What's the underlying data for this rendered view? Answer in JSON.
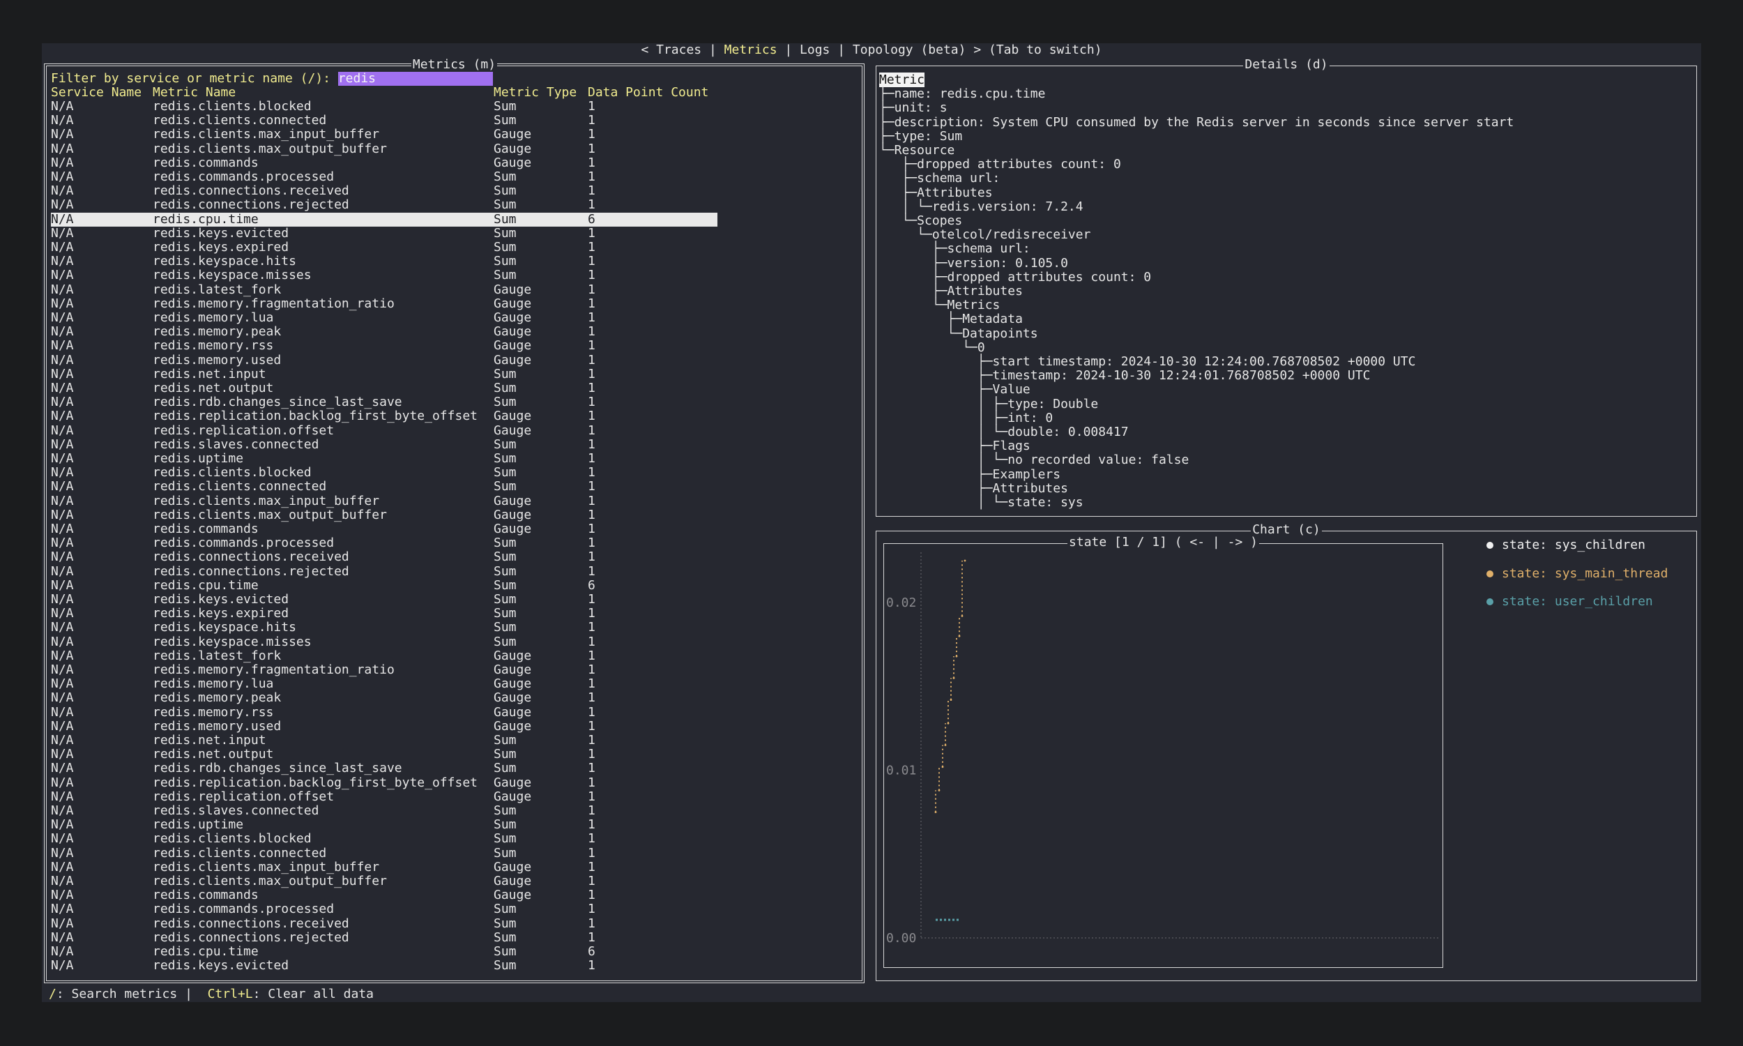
{
  "nav": {
    "prefix": "< ",
    "tabs": [
      "Traces",
      "Metrics",
      "Logs",
      "Topology (beta)"
    ],
    "active": "Metrics",
    "suffix": " > (Tab to switch)"
  },
  "metrics_panel": {
    "title": "Metrics (m)",
    "filter_label": "Filter by service or metric name (/): ",
    "filter_value": "redis",
    "columns": [
      "Service Name",
      "Metric Name",
      "Metric Type",
      "Data Point Count"
    ],
    "selected_index": 8,
    "rows": [
      [
        "N/A",
        "redis.clients.blocked",
        "Sum",
        "1"
      ],
      [
        "N/A",
        "redis.clients.connected",
        "Sum",
        "1"
      ],
      [
        "N/A",
        "redis.clients.max_input_buffer",
        "Gauge",
        "1"
      ],
      [
        "N/A",
        "redis.clients.max_output_buffer",
        "Gauge",
        "1"
      ],
      [
        "N/A",
        "redis.commands",
        "Gauge",
        "1"
      ],
      [
        "N/A",
        "redis.commands.processed",
        "Sum",
        "1"
      ],
      [
        "N/A",
        "redis.connections.received",
        "Sum",
        "1"
      ],
      [
        "N/A",
        "redis.connections.rejected",
        "Sum",
        "1"
      ],
      [
        "N/A",
        "redis.cpu.time",
        "Sum",
        "6"
      ],
      [
        "N/A",
        "redis.keys.evicted",
        "Sum",
        "1"
      ],
      [
        "N/A",
        "redis.keys.expired",
        "Sum",
        "1"
      ],
      [
        "N/A",
        "redis.keyspace.hits",
        "Sum",
        "1"
      ],
      [
        "N/A",
        "redis.keyspace.misses",
        "Sum",
        "1"
      ],
      [
        "N/A",
        "redis.latest_fork",
        "Gauge",
        "1"
      ],
      [
        "N/A",
        "redis.memory.fragmentation_ratio",
        "Gauge",
        "1"
      ],
      [
        "N/A",
        "redis.memory.lua",
        "Gauge",
        "1"
      ],
      [
        "N/A",
        "redis.memory.peak",
        "Gauge",
        "1"
      ],
      [
        "N/A",
        "redis.memory.rss",
        "Gauge",
        "1"
      ],
      [
        "N/A",
        "redis.memory.used",
        "Gauge",
        "1"
      ],
      [
        "N/A",
        "redis.net.input",
        "Sum",
        "1"
      ],
      [
        "N/A",
        "redis.net.output",
        "Sum",
        "1"
      ],
      [
        "N/A",
        "redis.rdb.changes_since_last_save",
        "Sum",
        "1"
      ],
      [
        "N/A",
        "redis.replication.backlog_first_byte_offset",
        "Gauge",
        "1"
      ],
      [
        "N/A",
        "redis.replication.offset",
        "Gauge",
        "1"
      ],
      [
        "N/A",
        "redis.slaves.connected",
        "Sum",
        "1"
      ],
      [
        "N/A",
        "redis.uptime",
        "Sum",
        "1"
      ],
      [
        "N/A",
        "redis.clients.blocked",
        "Sum",
        "1"
      ],
      [
        "N/A",
        "redis.clients.connected",
        "Sum",
        "1"
      ],
      [
        "N/A",
        "redis.clients.max_input_buffer",
        "Gauge",
        "1"
      ],
      [
        "N/A",
        "redis.clients.max_output_buffer",
        "Gauge",
        "1"
      ],
      [
        "N/A",
        "redis.commands",
        "Gauge",
        "1"
      ],
      [
        "N/A",
        "redis.commands.processed",
        "Sum",
        "1"
      ],
      [
        "N/A",
        "redis.connections.received",
        "Sum",
        "1"
      ],
      [
        "N/A",
        "redis.connections.rejected",
        "Sum",
        "1"
      ],
      [
        "N/A",
        "redis.cpu.time",
        "Sum",
        "6"
      ],
      [
        "N/A",
        "redis.keys.evicted",
        "Sum",
        "1"
      ],
      [
        "N/A",
        "redis.keys.expired",
        "Sum",
        "1"
      ],
      [
        "N/A",
        "redis.keyspace.hits",
        "Sum",
        "1"
      ],
      [
        "N/A",
        "redis.keyspace.misses",
        "Sum",
        "1"
      ],
      [
        "N/A",
        "redis.latest_fork",
        "Gauge",
        "1"
      ],
      [
        "N/A",
        "redis.memory.fragmentation_ratio",
        "Gauge",
        "1"
      ],
      [
        "N/A",
        "redis.memory.lua",
        "Gauge",
        "1"
      ],
      [
        "N/A",
        "redis.memory.peak",
        "Gauge",
        "1"
      ],
      [
        "N/A",
        "redis.memory.rss",
        "Gauge",
        "1"
      ],
      [
        "N/A",
        "redis.memory.used",
        "Gauge",
        "1"
      ],
      [
        "N/A",
        "redis.net.input",
        "Sum",
        "1"
      ],
      [
        "N/A",
        "redis.net.output",
        "Sum",
        "1"
      ],
      [
        "N/A",
        "redis.rdb.changes_since_last_save",
        "Sum",
        "1"
      ],
      [
        "N/A",
        "redis.replication.backlog_first_byte_offset",
        "Gauge",
        "1"
      ],
      [
        "N/A",
        "redis.replication.offset",
        "Gauge",
        "1"
      ],
      [
        "N/A",
        "redis.slaves.connected",
        "Sum",
        "1"
      ],
      [
        "N/A",
        "redis.uptime",
        "Sum",
        "1"
      ],
      [
        "N/A",
        "redis.clients.blocked",
        "Sum",
        "1"
      ],
      [
        "N/A",
        "redis.clients.connected",
        "Sum",
        "1"
      ],
      [
        "N/A",
        "redis.clients.max_input_buffer",
        "Gauge",
        "1"
      ],
      [
        "N/A",
        "redis.clients.max_output_buffer",
        "Gauge",
        "1"
      ],
      [
        "N/A",
        "redis.commands",
        "Gauge",
        "1"
      ],
      [
        "N/A",
        "redis.commands.processed",
        "Sum",
        "1"
      ],
      [
        "N/A",
        "redis.connections.received",
        "Sum",
        "1"
      ],
      [
        "N/A",
        "redis.connections.rejected",
        "Sum",
        "1"
      ],
      [
        "N/A",
        "redis.cpu.time",
        "Sum",
        "6"
      ],
      [
        "N/A",
        "redis.keys.evicted",
        "Sum",
        "1"
      ]
    ]
  },
  "details_panel": {
    "title": "Details (d)",
    "root": "Metric",
    "tree_lines": [
      "├─name: redis.cpu.time",
      "├─unit: s",
      "├─description: System CPU consumed by the Redis server in seconds since server start",
      "├─type: Sum",
      "└─Resource",
      "   ├─dropped attributes count: 0",
      "   ├─schema url:",
      "   ├─Attributes",
      "   │ └─redis.version: 7.2.4",
      "   └─Scopes",
      "     └─otelcol/redisreceiver",
      "       ├─schema url:",
      "       ├─version: 0.105.0",
      "       ├─dropped attributes count: 0",
      "       ├─Attributes",
      "       └─Metrics",
      "         ├─Metadata",
      "         └─Datapoints",
      "           └─0",
      "             ├─start timestamp: 2024-10-30 12:24:00.768708502 +0000 UTC",
      "             ├─timestamp: 2024-10-30 12:24:01.768708502 +0000 UTC",
      "             ├─Value",
      "             │ ├─type: Double",
      "             │ ├─int: 0",
      "             │ └─double: 0.008417",
      "             ├─Flags",
      "             │ └─no recorded value: false",
      "             ├─Examplers",
      "             ├─Attributes",
      "             │ └─state: sys"
    ]
  },
  "chart_panel": {
    "title": "Chart (c)",
    "chart_title": "state [1 / 1] ( <- | -> )"
  },
  "chart_data": {
    "type": "line",
    "title": "state [1 / 1] ( <- | -> )",
    "ylim": [
      0.0,
      0.023
    ],
    "yticks": [
      "0.00",
      "0.01",
      "0.02"
    ],
    "ytick_values": [
      0.0,
      0.01,
      0.02
    ],
    "legend_position": "right",
    "series": [
      {
        "name": "state: sys_children",
        "color": "#f0f0f0",
        "x": [],
        "y": []
      },
      {
        "name": "state: sys_main_thread",
        "color": "#e0b06a",
        "x": [
          0,
          1,
          2,
          3,
          4,
          5,
          6,
          7,
          8,
          9,
          10
        ],
        "y": [
          0.0075,
          0.0088,
          0.0102,
          0.0115,
          0.0128,
          0.0142,
          0.0155,
          0.0168,
          0.018,
          0.0192,
          0.0225
        ]
      },
      {
        "name": "state: user_children",
        "color": "#5aa0a8",
        "x": [
          0,
          1,
          2,
          3,
          4,
          5
        ],
        "y": [
          0.0011,
          0.0011,
          0.0011,
          0.0011,
          0.0011,
          0.0011
        ]
      }
    ]
  },
  "status_bar": {
    "search_key": "/",
    "search_label": ": Search metrics | ",
    "clear_key": "Ctrl+L",
    "clear_label": ": Clear all data"
  }
}
